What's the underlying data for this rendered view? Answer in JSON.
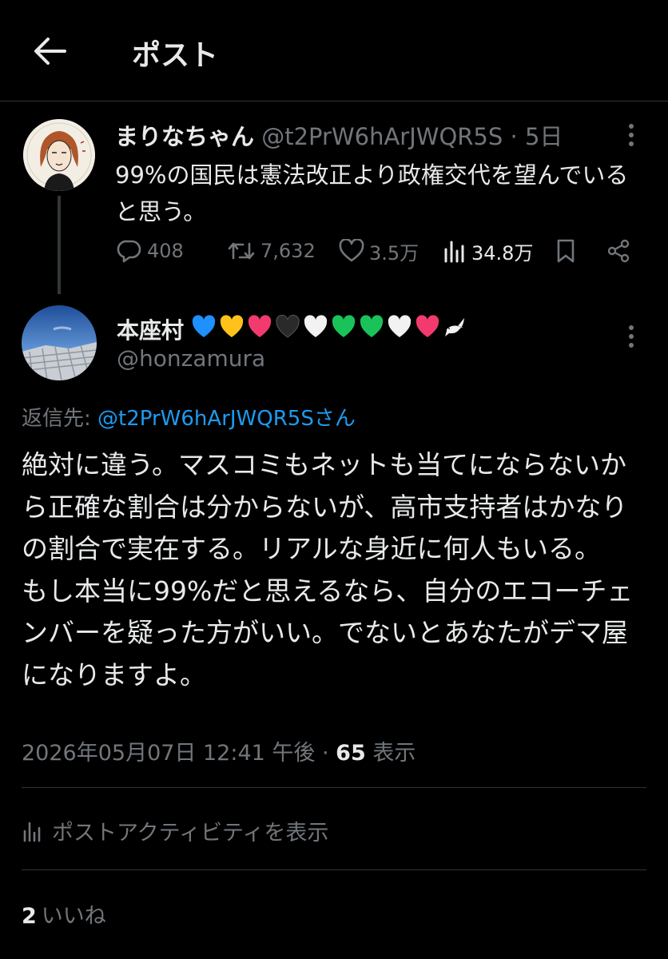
{
  "header": {
    "title": "ポスト"
  },
  "parent_post": {
    "author_name": "まりなちゃん",
    "handle": "@t2PrW6hArJWQR5S",
    "separator": "·",
    "age": "5日",
    "text": "99%の国民は憲法改正より政権交代を望んでいると思う。",
    "stats": {
      "replies": "408",
      "reposts": "7,632",
      "likes": "3.5万",
      "views": "34.8万"
    }
  },
  "reply_post": {
    "author_name": "本座村",
    "name_emojis": [
      "blue-heart",
      "yellow-heart",
      "pink-heart",
      "black-heart",
      "white-heart",
      "green-heart",
      "green-heart",
      "white-heart",
      "pink-heart",
      "dove"
    ],
    "handle": "@honzamura",
    "reply_to_label": "返信先: ",
    "reply_to_target": "@t2PrW6hArJWQR5Sさん",
    "text": "絶対に違う。マスコミもネットも当てにならないから正確な割合は分からないが、高市支持者はかなりの割合で実在する。リアルな身近に何人もいる。\nもし本当に99%だと思えるなら、自分のエコーチェンバーを疑った方がいい。でないとあなたがデマ屋になりますよ。",
    "timestamp": "2026年05月07日 12:41 午後",
    "meta_separator": " · ",
    "view_count": "65",
    "view_label": " 表示"
  },
  "activity": {
    "label": "ポストアクティビティを表示"
  },
  "likes": {
    "count": "2",
    "label": "いいね"
  },
  "colors": {
    "background": "#000000",
    "text_primary": "#e7e9ea",
    "text_secondary": "#71767b",
    "link": "#1d9bf0",
    "divider": "#2f3336"
  }
}
